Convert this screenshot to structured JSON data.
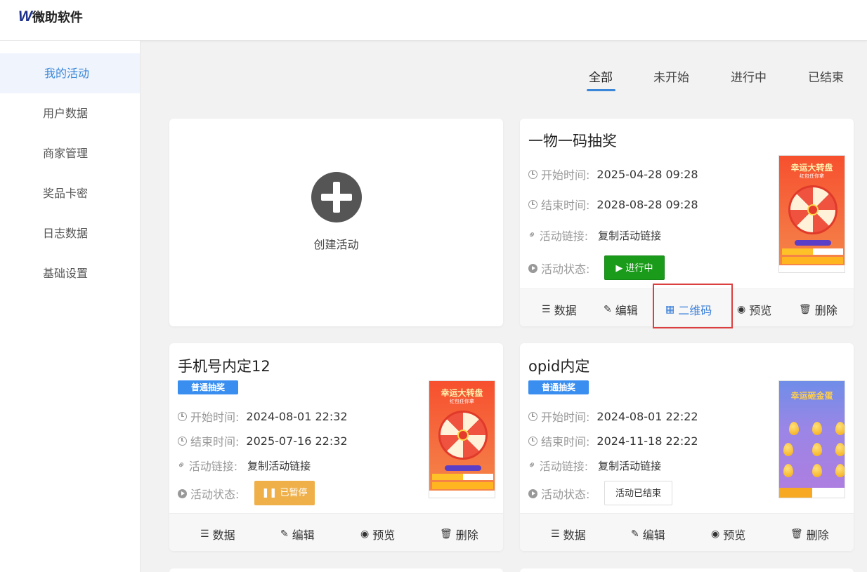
{
  "brand": {
    "mark": "W",
    "name": "微助软件"
  },
  "sidebar": {
    "items": [
      {
        "label": "我的活动",
        "active": true
      },
      {
        "label": "用户数据"
      },
      {
        "label": "商家管理"
      },
      {
        "label": "奖品卡密"
      },
      {
        "label": "日志数据"
      },
      {
        "label": "基础设置"
      }
    ]
  },
  "tabs": {
    "items": [
      {
        "label": "全部",
        "active": true
      },
      {
        "label": "未开始"
      },
      {
        "label": "进行中"
      },
      {
        "label": "已结束"
      }
    ]
  },
  "create_card": {
    "label": "创建活动"
  },
  "labels": {
    "start": "开始时间:",
    "end": "结束时间:",
    "link": "活动链接:",
    "status": "活动状态:"
  },
  "actions": {
    "data": "数据",
    "edit": "编辑",
    "qrcode": "二维码",
    "preview": "预览",
    "delete": "删除"
  },
  "activities": [
    {
      "title": "一物一码抽奖",
      "start": "2025-04-28 09:28",
      "end": "2028-08-28 09:28",
      "link_text": "复制活动链接",
      "status": "▶ 进行中",
      "thumb": {
        "title": "幸运大转盘",
        "sub": "红包任你拿"
      }
    },
    {
      "title": "手机号内定12",
      "tag": "普通抽奖",
      "start": "2024-08-01 22:32",
      "end": "2025-07-16 22:32",
      "link_text": "复制活动链接",
      "status": "❚❚ 已暂停",
      "thumb": {
        "title": "幸运大转盘",
        "sub": "红包任你拿"
      }
    },
    {
      "title": "opid内定",
      "tag": "普通抽奖",
      "start": "2024-08-01 22:22",
      "end": "2024-11-18 22:22",
      "link_text": "复制活动链接",
      "status": "活动已结束",
      "thumb": {
        "title": "幸运砸金蛋"
      }
    }
  ],
  "colors": {
    "accent": "#3a86d8",
    "running": "#1a9b1a",
    "paused": "#efb04a",
    "highlight": "#dc3f3f",
    "tag": "#3a8ef0"
  }
}
